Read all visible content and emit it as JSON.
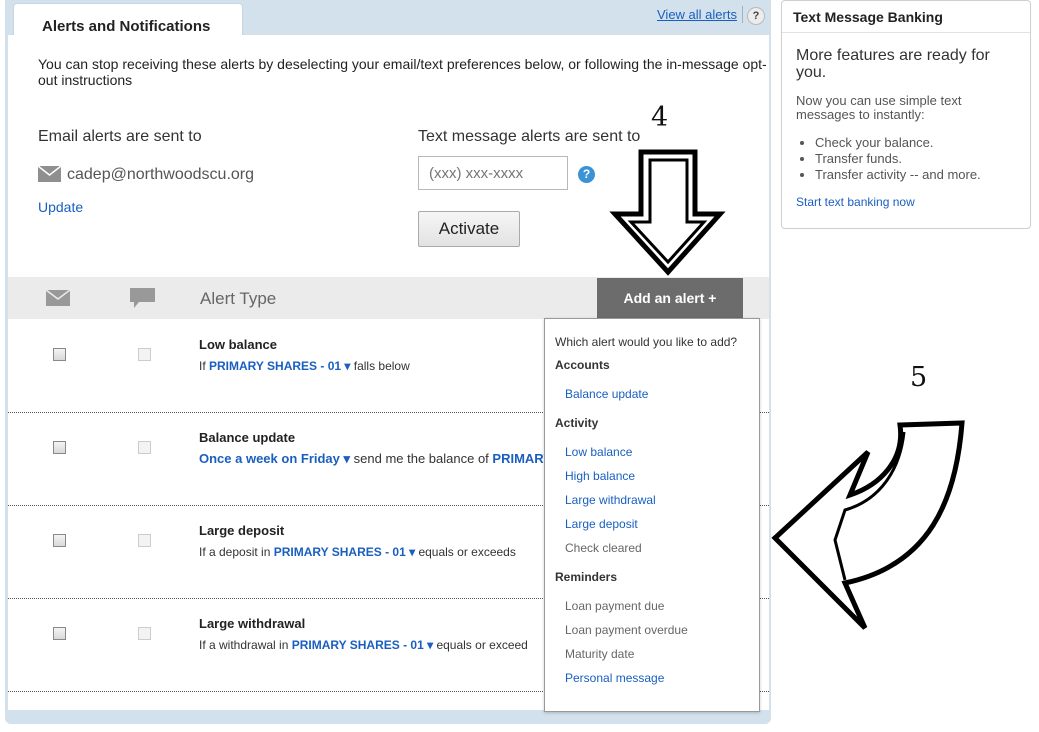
{
  "panel": {
    "tab_label": "Alerts and Notifications",
    "view_all_label": "View all alerts",
    "help_label": "?"
  },
  "intro": "You can stop receiving these alerts by deselecting your email/text preferences below, or following the in-message opt-out instructions",
  "email": {
    "heading": "Email alerts are sent to",
    "address": "cadep@northwoodscu.org",
    "update_label": "Update"
  },
  "sms": {
    "heading": "Text message alerts are sent to",
    "placeholder": "(xxx) xxx-xxxx",
    "help_label": "?",
    "activate_label": "Activate"
  },
  "table": {
    "alert_type_header": "Alert Type",
    "add_button_label": "Add an alert  +"
  },
  "rows": [
    {
      "title": "Low balance",
      "pre": "If ",
      "acct": "PRIMARY SHARES - 01 ▾",
      "post": " falls below"
    },
    {
      "title": "Balance update",
      "pre": "",
      "acct": "Once a week on Friday ▾",
      "post": " send me the balance of ",
      "acct2": "PRIMARY"
    },
    {
      "title": "Large deposit",
      "pre": "If a deposit in ",
      "acct": "PRIMARY SHARES - 01 ▾",
      "post": " equals or exceeds"
    },
    {
      "title": "Large withdrawal",
      "pre": "If a withdrawal in ",
      "acct": "PRIMARY SHARES - 01 ▾",
      "post": " equals or exceed"
    }
  ],
  "dropdown": {
    "question": "Which alert would you like to add?",
    "sections": [
      {
        "heading": "Accounts",
        "items": [
          {
            "label": "Balance update",
            "enabled": true
          }
        ]
      },
      {
        "heading": "Activity",
        "items": [
          {
            "label": "Low balance",
            "enabled": true
          },
          {
            "label": "High balance",
            "enabled": true
          },
          {
            "label": "Large withdrawal",
            "enabled": true
          },
          {
            "label": "Large deposit",
            "enabled": true
          },
          {
            "label": "Check cleared",
            "enabled": false
          }
        ]
      },
      {
        "heading": "Reminders",
        "items": [
          {
            "label": "Loan payment due",
            "enabled": false
          },
          {
            "label": "Loan payment overdue",
            "enabled": false
          },
          {
            "label": "Maturity date",
            "enabled": false
          },
          {
            "label": "Personal message",
            "enabled": true
          }
        ]
      }
    ]
  },
  "text_banking": {
    "title": "Text Message Banking",
    "more": "More features are ready for you.",
    "now": "Now you can use simple text messages to instantly:",
    "bullets": [
      "Check your balance.",
      "Transfer funds.",
      "Transfer activity -- and more."
    ],
    "start_label": "Start text banking now"
  },
  "annotations": {
    "step4": "4",
    "step5": "5"
  },
  "colors": {
    "link": "#1a5fc0",
    "panel_bg": "#d2e1ec",
    "add_button": "#6c6c6c",
    "help_blue": "#3b93d6"
  }
}
